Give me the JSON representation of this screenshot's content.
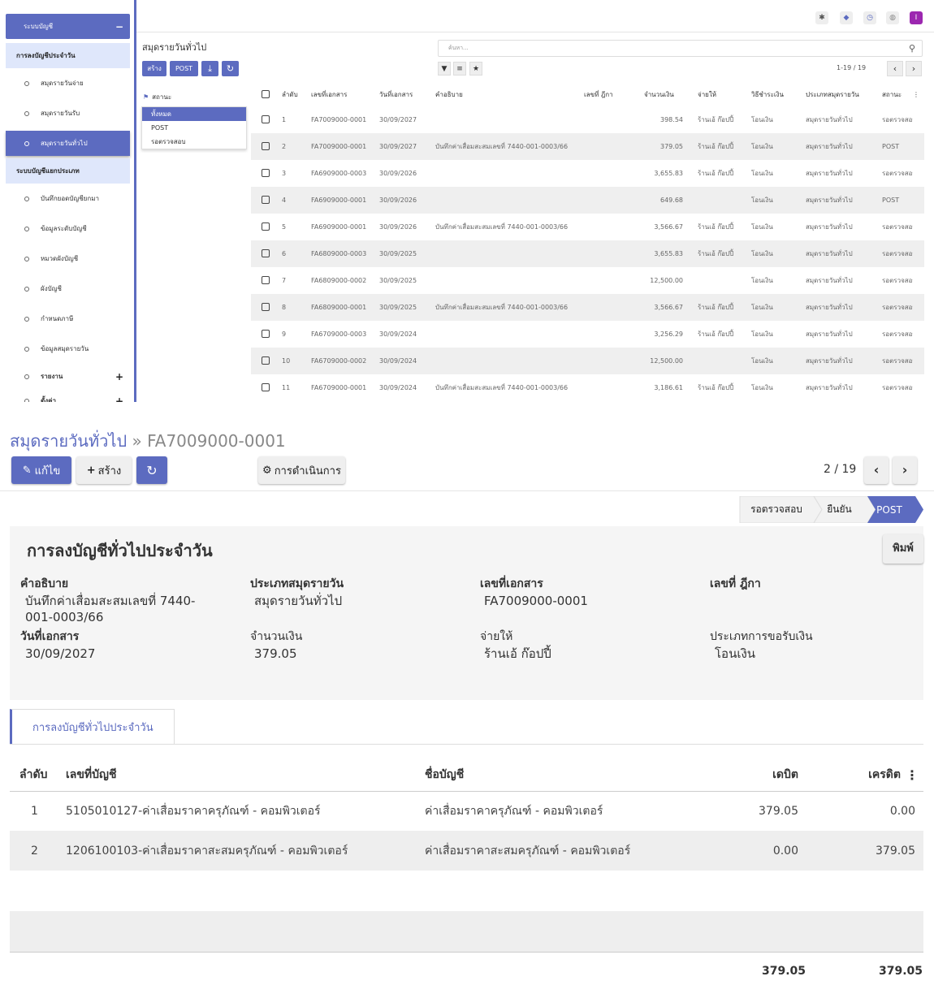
{
  "sidebar": {
    "group_title": "ระบบบัญชี",
    "group_toggle": "−",
    "section1": "การลงบัญชีประจำวัน",
    "items1": [
      "สมุดรายวันจ่าย",
      "สมุดรายวันรับ",
      "สมุดรายวันทั่วไป"
    ],
    "section2": "ระบบบัญชีแยกประเภท",
    "items2": [
      "บันทึกยอดบัญชียกมา",
      "ข้อมูลระดับบัญชี",
      "หมวดผังบัญชี",
      "ผังบัญชี",
      "กำหนดภาษี",
      "ข้อมูลสมุดรายวัน"
    ],
    "reports": "รายงาน",
    "settings": "ตั้งค่า",
    "plus": "+"
  },
  "topbar": {
    "icons": [
      "bug-icon",
      "chat-icon",
      "clock-icon",
      "globe-icon",
      "user-avatar"
    ],
    "avatar_letter": "I"
  },
  "list": {
    "title": "สมุดรายวันทั่วไป",
    "create": "สร้าง",
    "post": "POST",
    "download_icon": "⤓",
    "refresh_icon": "↻",
    "search_placeholder": "ค้นหา...",
    "search_icon": "⚲",
    "pager": "1-19 / 19",
    "facet_title": "สถานะ",
    "facet_options": [
      "ทั้งหมด",
      "POST",
      "รอตรวจสอบ"
    ],
    "columns": [
      "ลำดับ",
      "เลขที่เอกสาร",
      "วันที่เอกสาร",
      "คำอธิบาย",
      "เลขที่ ฎีกา",
      "จำนวนเงิน",
      "จ่ายให้",
      "วิธีชำระเงิน",
      "ประเภทสมุดรายวัน",
      "สถานะ"
    ],
    "rows": [
      [
        "1",
        "FA7009000-0001",
        "30/09/2027",
        "",
        "",
        "398.54",
        "ร้านเอ้ ก๊อปปี้",
        "โอนเงิน",
        "สมุดรายวันทั่วไป",
        "รอตรวจสอบ"
      ],
      [
        "2",
        "FA7009000-0001",
        "30/09/2027",
        "บันทึกค่าเสื่อมสะสมเลขที่ 7440-001-0003/66",
        "",
        "379.05",
        "ร้านเอ้ ก๊อปปี้",
        "โอนเงิน",
        "สมุดรายวันทั่วไป",
        "POST"
      ],
      [
        "3",
        "FA6909000-0003",
        "30/09/2026",
        "",
        "",
        "3,655.83",
        "ร้านเอ้ ก๊อปปี้",
        "โอนเงิน",
        "สมุดรายวันทั่วไป",
        "รอตรวจสอบ"
      ],
      [
        "4",
        "FA6909000-0001",
        "30/09/2026",
        "",
        "",
        "649.68",
        "",
        "โอนเงิน",
        "สมุดรายวันทั่วไป",
        "POST"
      ],
      [
        "5",
        "FA6909000-0001",
        "30/09/2026",
        "บันทึกค่าเสื่อมสะสมเลขที่ 7440-001-0003/66",
        "",
        "3,566.67",
        "ร้านเอ้ ก๊อปปี้",
        "โอนเงิน",
        "สมุดรายวันทั่วไป",
        "รอตรวจสอบ"
      ],
      [
        "6",
        "FA6809000-0003",
        "30/09/2025",
        "",
        "",
        "3,655.83",
        "ร้านเอ้ ก๊อปปี้",
        "โอนเงิน",
        "สมุดรายวันทั่วไป",
        "รอตรวจสอบ"
      ],
      [
        "7",
        "FA6809000-0002",
        "30/09/2025",
        "",
        "",
        "12,500.00",
        "",
        "โอนเงิน",
        "สมุดรายวันทั่วไป",
        "รอตรวจสอบ"
      ],
      [
        "8",
        "FA6809000-0001",
        "30/09/2025",
        "บันทึกค่าเสื่อมสะสมเลขที่ 7440-001-0003/66",
        "",
        "3,566.67",
        "ร้านเอ้ ก๊อปปี้",
        "โอนเงิน",
        "สมุดรายวันทั่วไป",
        "รอตรวจสอบ"
      ],
      [
        "9",
        "FA6709000-0003",
        "30/09/2024",
        "",
        "",
        "3,256.29",
        "ร้านเอ้ ก๊อปปี้",
        "โอนเงิน",
        "สมุดรายวันทั่วไป",
        "รอตรวจสอบ"
      ],
      [
        "10",
        "FA6709000-0002",
        "30/09/2024",
        "",
        "",
        "12,500.00",
        "",
        "โอนเงิน",
        "สมุดรายวันทั่วไป",
        "รอตรวจสอบ"
      ],
      [
        "11",
        "FA6709000-0001",
        "30/09/2024",
        "บันทึกค่าเสื่อมสะสมเลขที่ 7440-001-0003/66",
        "",
        "3,186.61",
        "ร้านเอ้ ก๊อปปี้",
        "โอนเงิน",
        "สมุดรายวันทั่วไป",
        "รอตรวจสอบ"
      ]
    ]
  },
  "form": {
    "crumb_parent": "สมุดรายวันทั่วไป",
    "crumb_sep": "»",
    "crumb_current": "FA7009000-0001",
    "edit": "แก้ไข",
    "create": "สร้าง",
    "action": "การดำเนินการ",
    "pager": "2 / 19",
    "stages": [
      "รอตรวจสอบ",
      "ยืนยัน",
      "POST"
    ],
    "title": "การลงบัญชีทั่วไปประจำวัน",
    "print": "พิมพ์",
    "fields": {
      "desc_label": "คำอธิบาย",
      "desc_value": "บันทึกค่าเสื่อมสะสมเลขที่ 7440-001-0003/66",
      "journal_label": "ประเภทสมุดรายวัน",
      "journal_value": "สมุดรายวันทั่วไป",
      "docno_label": "เลขที่เอกสาร",
      "docno_value": "FA7009000-0001",
      "voucher_label": "เลขที่ ฎีกา",
      "date_label": "วันที่เอกสาร",
      "date_value": "30/09/2027",
      "amount_label": "จำนวนเงิน",
      "amount_value": "379.05",
      "payee_label": "จ่ายให้",
      "payee_value": "ร้านเอ้ ก๊อปปี้",
      "paytype_label": "ประเภทการขอรับเงิน",
      "paytype_value": "โอนเงิน"
    },
    "tab": "การลงบัญชีทั่วไปประจำวัน",
    "line_columns": [
      "ลำดับ",
      "เลขที่บัญชี",
      "ชื่อบัญชี",
      "เดบิต",
      "เครดิต"
    ],
    "lines": [
      [
        "1",
        "5105010127-ค่าเสื่อมราคาครุภัณฑ์ - คอมพิวเตอร์",
        "ค่าเสื่อมราคาครุภัณฑ์ - คอมพิวเตอร์",
        "379.05",
        "0.00"
      ],
      [
        "2",
        "1206100103-ค่าเสื่อมราคาสะสมครุภัณฑ์ - คอมพิวเตอร์",
        "ค่าเสื่อมราคาสะสมครุภัณฑ์ - คอมพิวเตอร์",
        "0.00",
        "379.05"
      ]
    ],
    "total_debit": "379.05",
    "total_credit": "379.05"
  },
  "colors": {
    "accent": "#5c6bc0",
    "avatar": "#9c27b0"
  }
}
